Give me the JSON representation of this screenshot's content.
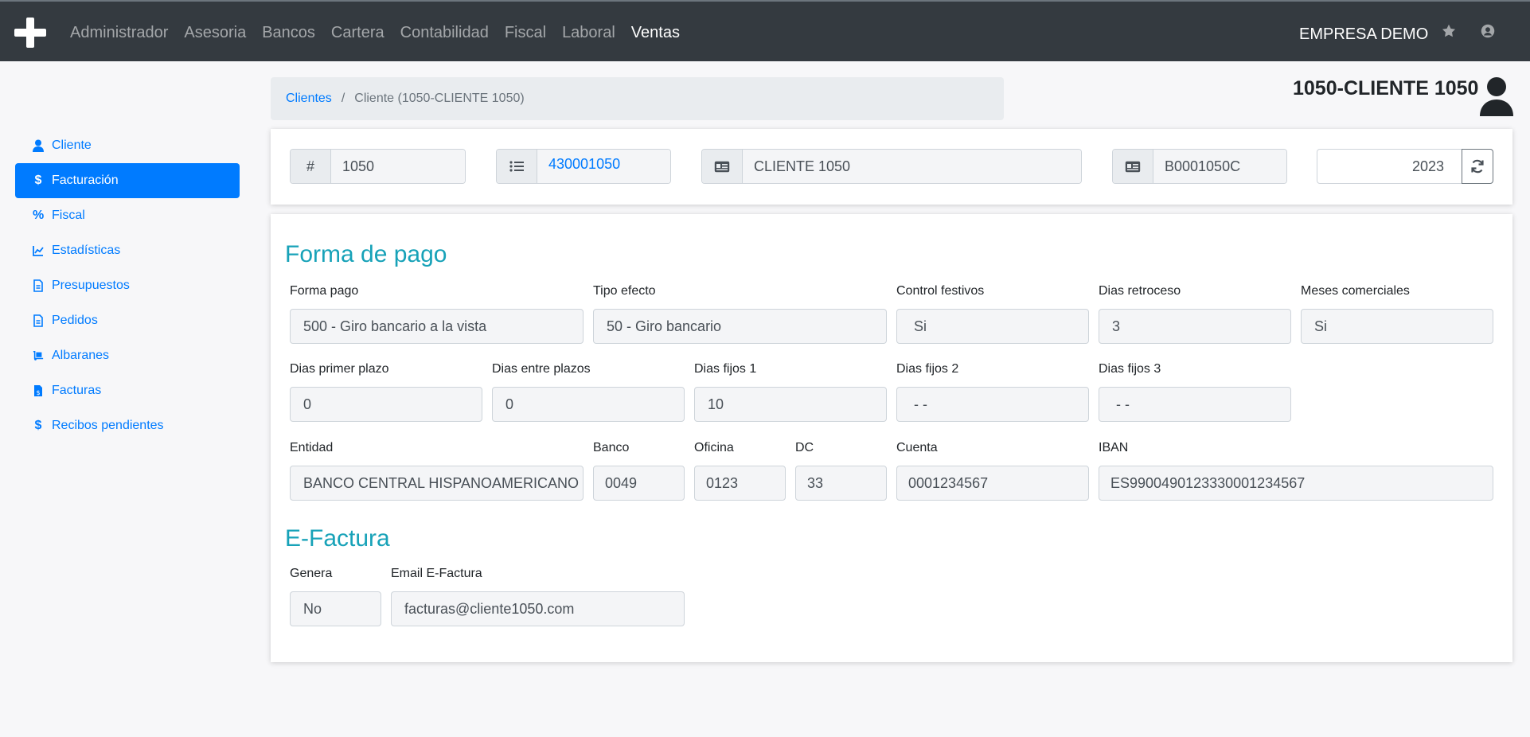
{
  "nav": {
    "items": [
      "Administrador",
      "Asesoria",
      "Bancos",
      "Cartera",
      "Contabilidad",
      "Fiscal",
      "Laboral",
      "Ventas"
    ],
    "active": "Ventas",
    "company": "EMPRESA DEMO",
    "icons": [
      "plus-logo-icon",
      "star-icon",
      "user-circle-icon"
    ]
  },
  "breadcrumb": {
    "root": "Clientes",
    "separator": "/",
    "current": "Cliente (1050-CLIENTE 1050)"
  },
  "client_title": "1050-CLIENTE 1050",
  "sidebar": {
    "items": [
      {
        "label": "Cliente",
        "icon": "user-icon"
      },
      {
        "label": "Facturación",
        "icon": "dollar-icon"
      },
      {
        "label": "Fiscal",
        "icon": "percent-icon"
      },
      {
        "label": "Estadísticas",
        "icon": "chart-line-icon"
      },
      {
        "label": "Presupuestos",
        "icon": "file-icon"
      },
      {
        "label": "Pedidos",
        "icon": "file-icon"
      },
      {
        "label": "Albaranes",
        "icon": "dolly-icon"
      },
      {
        "label": "Facturas",
        "icon": "file-invoice-icon"
      },
      {
        "label": "Recibos pendientes",
        "icon": "dollar-icon"
      }
    ],
    "active": "Facturación"
  },
  "header": {
    "hash_addon": "#",
    "code": "1050",
    "account": "430001050",
    "name": "CLIENTE 1050",
    "nif": "B0001050C",
    "year": "2023"
  },
  "pago": {
    "title": "Forma de pago",
    "forma_pago": {
      "label": "Forma pago",
      "value": "500 - Giro bancario a la vista"
    },
    "tipo_efecto": {
      "label": "Tipo efecto",
      "value": "50 - Giro bancario"
    },
    "control_festivos": {
      "label": "Control festivos",
      "value": "Si"
    },
    "dias_retroceso": {
      "label": "Dias retroceso",
      "value": "3"
    },
    "meses_comerciales": {
      "label": "Meses comerciales",
      "value": "Si"
    },
    "dias_primer_plazo": {
      "label": "Dias primer plazo",
      "value": "0"
    },
    "dias_entre_plazos": {
      "label": "Dias entre plazos",
      "value": "0"
    },
    "dias_fijos_1": {
      "label": "Dias fijos 1",
      "value": "10"
    },
    "dias_fijos_2": {
      "label": "Dias fijos 2",
      "value": "- -"
    },
    "dias_fijos_3": {
      "label": "Dias fijos 3",
      "value": "- -"
    },
    "entidad": {
      "label": "Entidad",
      "value": "BANCO CENTRAL HISPANOAMERICANO"
    },
    "banco": {
      "label": "Banco",
      "value": "0049"
    },
    "oficina": {
      "label": "Oficina",
      "value": "0123"
    },
    "dc": {
      "label": "DC",
      "value": "33"
    },
    "cuenta": {
      "label": "Cuenta",
      "value": "0001234567"
    },
    "iban": {
      "label": "IBAN",
      "value": "ES9900490123330001234567"
    }
  },
  "efactura": {
    "title": "E-Factura",
    "genera": {
      "label": "Genera",
      "value": "No"
    },
    "email": {
      "label": "Email E-Factura",
      "value": "facturas@cliente1050.com"
    }
  },
  "colors": {
    "navbar": "#343a40",
    "primary": "#007bff",
    "section": "#17a2b8"
  }
}
